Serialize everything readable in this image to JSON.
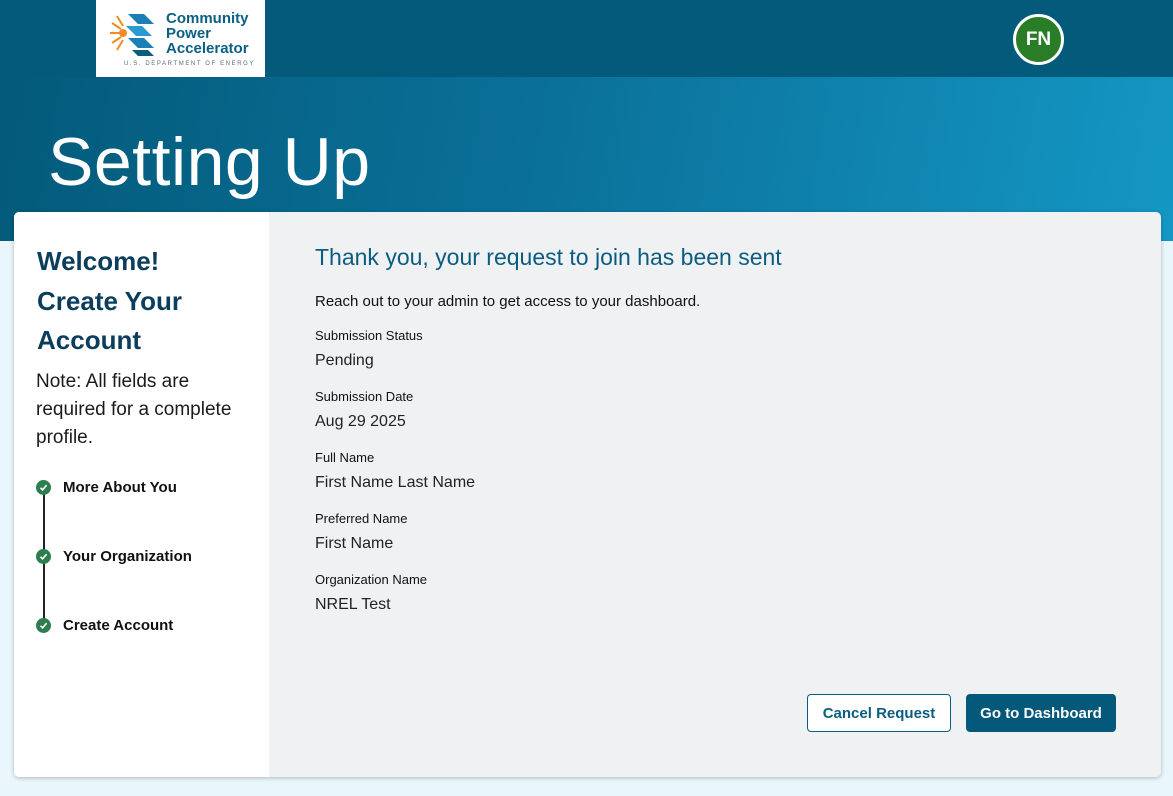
{
  "header": {
    "logo": {
      "line1": "Community",
      "line2": "Power",
      "line3": "Accelerator",
      "subtitle": "U.S. DEPARTMENT OF ENERGY",
      "icon": "community-power-accelerator-logo"
    },
    "avatar_initials": "FN"
  },
  "hero": {
    "title": "Setting Up"
  },
  "sidebar": {
    "title_lines": [
      "Welcome!",
      "Create Your",
      "Account"
    ],
    "note": "Note: All fields are required for a complete profile.",
    "steps": [
      {
        "label": "More About You",
        "icon": "check-circle-icon"
      },
      {
        "label": "Your Organization",
        "icon": "check-circle-icon"
      },
      {
        "label": "Create Account",
        "icon": "check-circle-icon"
      }
    ]
  },
  "main": {
    "heading": "Thank you, your request to join has been sent",
    "intro": "Reach out to your admin to get access to your dashboard.",
    "fields": [
      {
        "label": "Submission Status",
        "value": "Pending"
      },
      {
        "label": "Submission Date",
        "value": "Aug 29 2025"
      },
      {
        "label": "Full Name",
        "value": "First Name Last Name"
      },
      {
        "label": "Preferred Name",
        "value": "First Name"
      },
      {
        "label": "Organization Name",
        "value": "NREL Test"
      }
    ],
    "buttons": {
      "cancel": "Cancel Request",
      "dashboard": "Go to Dashboard"
    }
  },
  "colors": {
    "topbar": "#035a7a",
    "accent": "#0b5d80",
    "avatar": "#2a7d27",
    "step_check": "#2e7d4f",
    "primary_button": "#045879"
  }
}
